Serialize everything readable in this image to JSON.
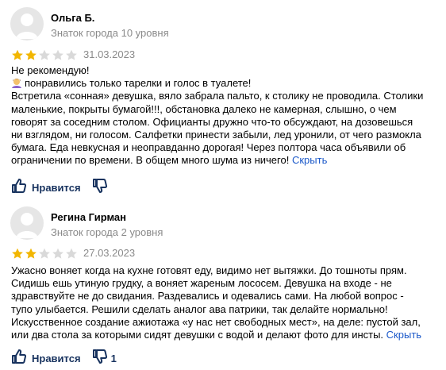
{
  "reviews": [
    {
      "author": "Ольга Б.",
      "level": "Знаток города 10 уровня",
      "rating": 2,
      "rating_max": 5,
      "date": "31.03.2023",
      "lines": [
        "Не рекомендую!",
        "понравились только тарелки и голос в туалете!",
        "Встретила «сонная» девушка, вяло забрала пальто, к столику не проводила. Столики",
        "маленькие, покрыты бумагой!!!, обстановка далеко не камерная, слышно, о чем",
        "говорят за соседним столом. Официанты дружно что-то обсуждают, на дозовешься",
        "ни взглядом, ни голосом. Салфетки принести забыли, лед уронили, от чего размокла",
        "бумага. Еда невкусная и неоправданно дорогая! Через полтора часа объявили об",
        "ограничении по времени. В общем много шума из ничего!"
      ],
      "collapse_label": "Скрыть",
      "like_label": "Нравится",
      "dislike_count": ""
    },
    {
      "author": "Регина Гирман",
      "level": "Знаток города 2 уровня",
      "rating": 2,
      "rating_max": 5,
      "date": "27.03.2023",
      "lines": [
        "Ужасно воняет когда на кухне готовят еду, видимо нет вытяжки. До тошноты прям.",
        "Сидишь ешь утиную грудку, а воняет жареным лососем. Девушка на входе - не",
        "здравствуйте не до свидания. Раздевались и одевались сами. На любой вопрос -",
        "тупо улыбается. Решили сделать аналог ава патрики, так делайте нормально!",
        "Искусственное создание ажиотажа «у нас нет свободных мест», на деле: пустой зал,",
        "или два стола за которыми сидят девушки с водой и делают фото для инсты."
      ],
      "collapse_label": "Скрыть",
      "like_label": "Нравится",
      "dislike_count": "1"
    }
  ],
  "colors": {
    "star_filled": "#f2b600",
    "star_empty": "#d9d9d9",
    "link": "#1a58c9",
    "action": "#17325e",
    "muted": "#8a8a8a"
  },
  "icons": {
    "avatar": "default-user-avatar",
    "like": "thumbs-up-icon",
    "dislike": "thumbs-down-icon",
    "emoji": "woman-facepalming-emoji"
  }
}
